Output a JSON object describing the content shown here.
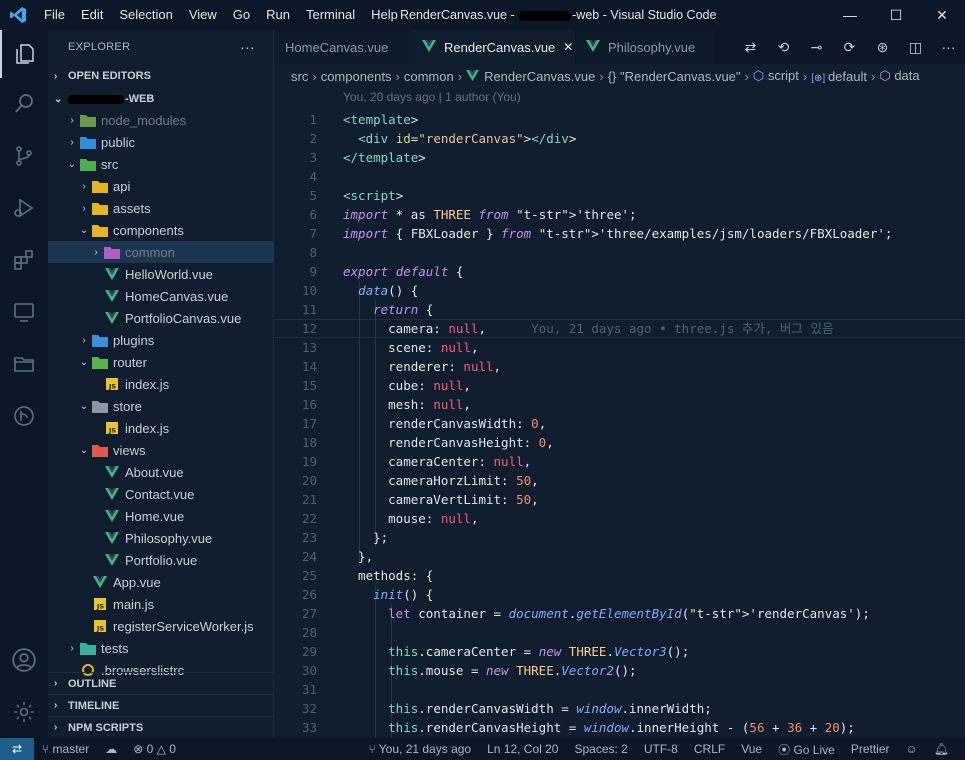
{
  "titlebar": {
    "menu": [
      "File",
      "Edit",
      "Selection",
      "View",
      "Go",
      "Run",
      "Terminal",
      "Help"
    ],
    "title_prefix": "RenderCanvas.vue - ",
    "title_suffix": "-web - Visual Studio Code",
    "minimize": "—",
    "maximize": "☐",
    "close": "✕"
  },
  "explorer": {
    "header": "EXPLORER",
    "more": "···",
    "open_editors": "OPEN EDITORS",
    "root": "-WEB",
    "items": [
      {
        "label": "node_modules",
        "depth": 1,
        "kind": "folder-closed",
        "icon": "node"
      },
      {
        "label": "public",
        "depth": 1,
        "kind": "folder-closed",
        "icon": "public"
      },
      {
        "label": "src",
        "depth": 1,
        "kind": "folder-open",
        "icon": "src"
      },
      {
        "label": "api",
        "depth": 2,
        "kind": "folder-closed",
        "icon": "folder-yellow"
      },
      {
        "label": "assets",
        "depth": 2,
        "kind": "folder-closed",
        "icon": "folder-yellow"
      },
      {
        "label": "components",
        "depth": 2,
        "kind": "folder-open",
        "icon": "folder-yellow"
      },
      {
        "label": "common",
        "depth": 3,
        "kind": "folder-closed",
        "icon": "folder-purple"
      },
      {
        "label": "HelloWorld.vue",
        "depth": 3,
        "kind": "file",
        "icon": "vue"
      },
      {
        "label": "HomeCanvas.vue",
        "depth": 3,
        "kind": "file",
        "icon": "vue"
      },
      {
        "label": "PortfolioCanvas.vue",
        "depth": 3,
        "kind": "file",
        "icon": "vue"
      },
      {
        "label": "plugins",
        "depth": 2,
        "kind": "folder-closed",
        "icon": "folder-blue"
      },
      {
        "label": "router",
        "depth": 2,
        "kind": "folder-open",
        "icon": "folder-green"
      },
      {
        "label": "index.js",
        "depth": 3,
        "kind": "file",
        "icon": "js"
      },
      {
        "label": "store",
        "depth": 2,
        "kind": "folder-open",
        "icon": "folder-gray"
      },
      {
        "label": "index.js",
        "depth": 3,
        "kind": "file",
        "icon": "js"
      },
      {
        "label": "views",
        "depth": 2,
        "kind": "folder-open",
        "icon": "folder-red"
      },
      {
        "label": "About.vue",
        "depth": 3,
        "kind": "file",
        "icon": "vue"
      },
      {
        "label": "Contact.vue",
        "depth": 3,
        "kind": "file",
        "icon": "vue"
      },
      {
        "label": "Home.vue",
        "depth": 3,
        "kind": "file",
        "icon": "vue"
      },
      {
        "label": "Philosophy.vue",
        "depth": 3,
        "kind": "file",
        "icon": "vue"
      },
      {
        "label": "Portfolio.vue",
        "depth": 3,
        "kind": "file",
        "icon": "vue"
      },
      {
        "label": "App.vue",
        "depth": 2,
        "kind": "file",
        "icon": "vue"
      },
      {
        "label": "main.js",
        "depth": 2,
        "kind": "file",
        "icon": "js"
      },
      {
        "label": "registerServiceWorker.js",
        "depth": 2,
        "kind": "file",
        "icon": "js"
      },
      {
        "label": "tests",
        "depth": 1,
        "kind": "folder-closed",
        "icon": "folder-teal"
      },
      {
        "label": ".browserslistrc",
        "depth": 1,
        "kind": "file",
        "icon": "browsers"
      }
    ],
    "outline": "OUTLINE",
    "timeline": "TIMELINE",
    "npm": "NPM SCRIPTS"
  },
  "tabs": [
    {
      "label": "HomeCanvas.vue",
      "active": false
    },
    {
      "label": "RenderCanvas.vue",
      "active": true,
      "close": "✕"
    },
    {
      "label": "Philosophy.vue",
      "active": false
    }
  ],
  "breadcrumb": [
    "src",
    "components",
    "common",
    "RenderCanvas.vue",
    "{} \"RenderCanvas.vue\"",
    "script",
    "default",
    "data"
  ],
  "blame_header": "You, 20 days ago | 1 author (You)",
  "inline_blame": "You, 21 days ago • three.js 추가, 버그 있음",
  "code_lines": [
    "<template>",
    "  <div id=\"renderCanvas\"></div>",
    "</template>",
    "",
    "<script>",
    "import * as THREE from 'three';",
    "import { FBXLoader } from 'three/examples/jsm/loaders/FBXLoader';",
    "",
    "export default {",
    "  data() {",
    "    return {",
    "      camera: null,",
    "      scene: null,",
    "      renderer: null,",
    "      cube: null,",
    "      mesh: null,",
    "      renderCanvasWidth: 0,",
    "      renderCanvasHeight: 0,",
    "      cameraCenter: null,",
    "      cameraHorzLimit: 50,",
    "      cameraVertLimit: 50,",
    "      mouse: null,",
    "    };",
    "  },",
    "  methods: {",
    "    init() {",
    "      let container = document.getElementById('renderCanvas');",
    "",
    "      this.cameraCenter = new THREE.Vector3();",
    "      this.mouse = new THREE.Vector2();",
    "",
    "      this.renderCanvasWidth = window.innerWidth;",
    "      this.renderCanvasHeight = window.innerHeight - (56 + 36 + 20);"
  ],
  "status": {
    "branch": "master",
    "errors": "0",
    "warnings": "0",
    "blame": "You, 21 days ago",
    "position": "Ln 12, Col 20",
    "spaces": "Spaces: 2",
    "encoding": "UTF-8",
    "eol": "CRLF",
    "language": "Vue",
    "golive": "Go Live",
    "prettier": "Prettier"
  }
}
